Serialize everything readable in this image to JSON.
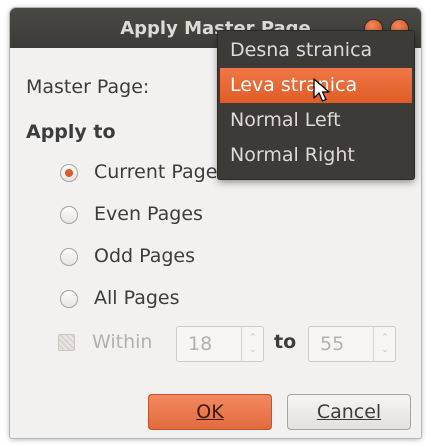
{
  "window": {
    "title": "Apply Master Page"
  },
  "master_page": {
    "label": "Master Page:"
  },
  "apply_to": {
    "heading": "Apply to",
    "options": [
      {
        "label": "Current Page",
        "checked": true
      },
      {
        "label": "Even Pages",
        "checked": false
      },
      {
        "label": "Odd Pages",
        "checked": false
      },
      {
        "label": "All Pages",
        "checked": false
      }
    ]
  },
  "range": {
    "within_label": "Within",
    "from_value": "18",
    "to_label": "to",
    "to_value": "55",
    "enabled": false
  },
  "buttons": {
    "ok_label": "OK",
    "cancel_label": "Cancel"
  },
  "dropdown_menu": {
    "items": [
      "Desna stranica",
      "Leva stranica",
      "Normal Left",
      "Normal Right"
    ],
    "selected": "Leva stranica"
  },
  "colors": {
    "accent": "#e05c27",
    "menu_bg": "#3c3b37",
    "titlebar_bg": "#3c3b37"
  }
}
